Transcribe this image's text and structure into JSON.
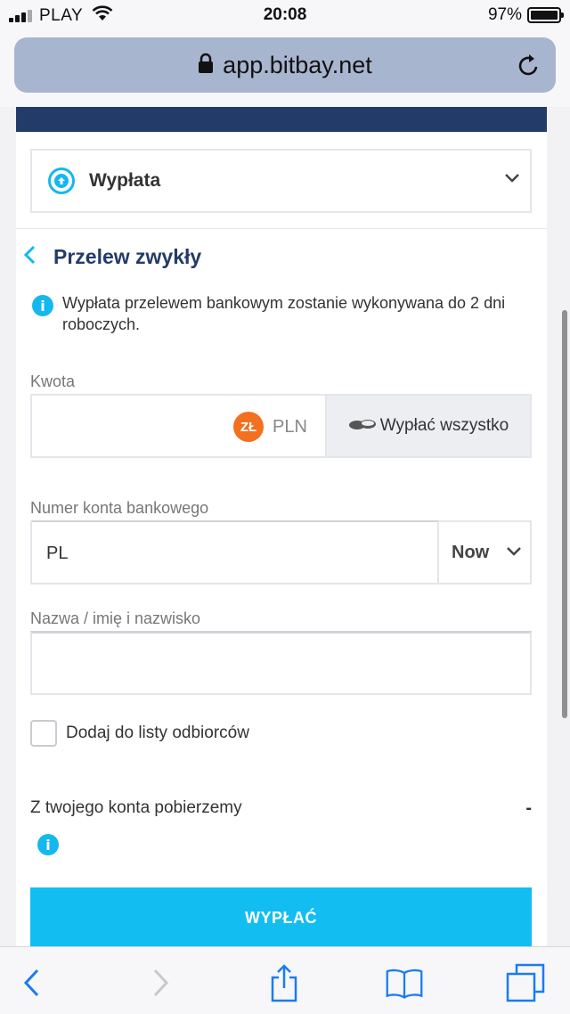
{
  "status_bar": {
    "carrier": "PLAY",
    "time": "20:08",
    "battery": "97%"
  },
  "browser": {
    "url": "app.bitbay.net"
  },
  "form": {
    "operation": "Wypłata",
    "method_title": "Przelew zwykły",
    "info_text": "Wypłata przelewem bankowym zostanie wykonywana do 2 dni roboczych.",
    "amount": {
      "label": "Kwota",
      "currency_badge": "ZŁ",
      "currency": "PLN",
      "withdraw_all": "Wypłać wszystko"
    },
    "account": {
      "label": "Numer konta bankowego",
      "value": "PL",
      "select": "Now"
    },
    "name": {
      "label": "Nazwa / imię i nazwisko",
      "value": ""
    },
    "add_to_recipients": "Dodaj do listy odbiorców",
    "fee_label": "Z twojego konta pobierzemy",
    "fee_value": "-",
    "submit": "WYPŁAĆ"
  },
  "colors": {
    "accent": "#12bdf2",
    "navy": "#233b68",
    "currency_badge": "#f37021"
  },
  "icons": {
    "toolbar": [
      "back-icon",
      "forward-icon",
      "share-icon",
      "bookmarks-icon",
      "tabs-icon"
    ]
  }
}
